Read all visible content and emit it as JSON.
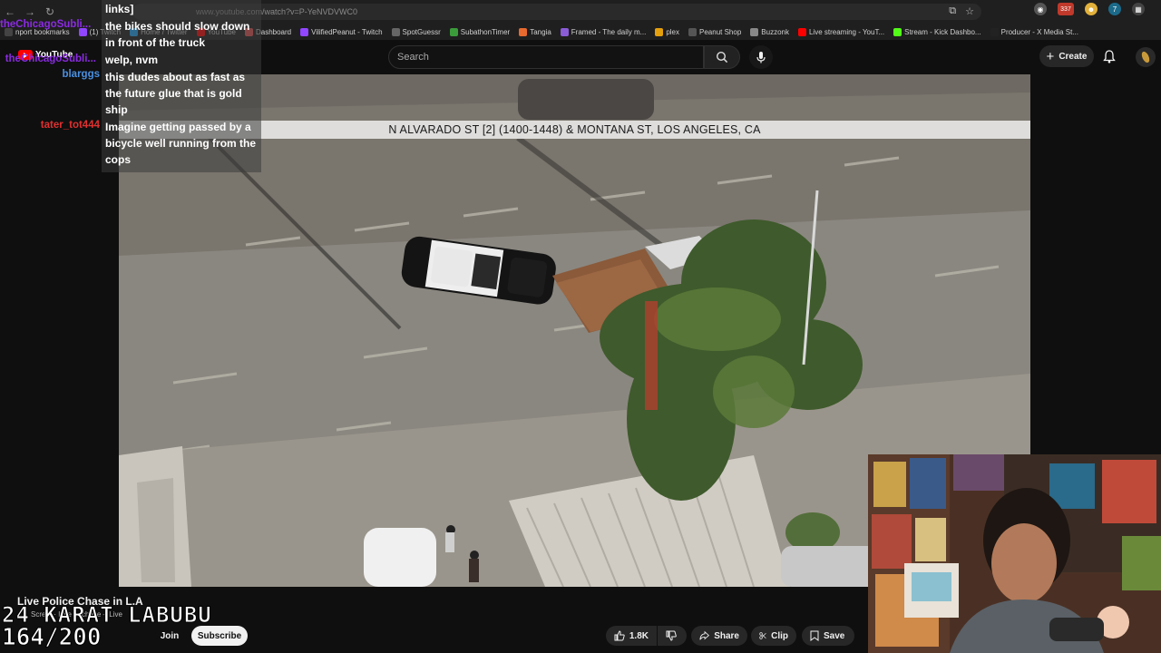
{
  "browser": {
    "url": "www.youtube.com/watch?v=P-YeNVDVWC0",
    "nav_icons": [
      "back-icon",
      "forward-icon",
      "reload-icon"
    ],
    "bookmarks": [
      {
        "label": "nport bookmarks",
        "color": "#444444"
      },
      {
        "label": "(1) Twitch",
        "color": "#9146ff"
      },
      {
        "label": "Home / Twitter",
        "color": "#1da1f2"
      },
      {
        "label": "YouTube",
        "color": "#ff0000"
      },
      {
        "label": "Dashboard",
        "color": "#e05050"
      },
      {
        "label": "VilifiedPeanut - Twitch",
        "color": "#9146ff"
      },
      {
        "label": "SpotGuessr",
        "color": "#666666"
      },
      {
        "label": "SubathonTimer",
        "color": "#3b9b3b"
      },
      {
        "label": "Tangia",
        "color": "#e86a2e"
      },
      {
        "label": "Framed - The daily m...",
        "color": "#8a5cd6"
      },
      {
        "label": "plex",
        "color": "#e5a00d"
      },
      {
        "label": "Peanut Shop",
        "color": "#555555"
      },
      {
        "label": "Buzzonk",
        "color": "#888888"
      },
      {
        "label": "Live streaming - YouT...",
        "color": "#ff0000"
      },
      {
        "label": "Stream - Kick Dashbo...",
        "color": "#53fc18"
      },
      {
        "label": "Producer - X Media St...",
        "color": "#222222"
      }
    ],
    "extension_badge": "337"
  },
  "youtube": {
    "logo_text": "YouTube",
    "search_placeholder": "Search",
    "create_label": "Create"
  },
  "video": {
    "caption": "N ALVARADO ST [2] (1400-1448) & MONTANA ST, LOS ANGELES, CA",
    "title": "Live Police Chase in L.A",
    "channel_ghost": "Scre... · Live ... chase – Live",
    "join_label": "Join",
    "subscribe_label": "Subscribe",
    "likes": "1.8K",
    "share_label": "Share",
    "clip_label": "Clip",
    "save_label": "Save"
  },
  "chat": {
    "header_fragment": "links]",
    "messages": [
      {
        "user": "theChicagoSubli...",
        "user_color": "#8a2be2",
        "text": "the bikes should slow down in front of the truck"
      },
      {
        "user": "theChicagoSubli...",
        "user_color": "#8a2be2",
        "text": "welp, nvm"
      },
      {
        "user": "blarggs",
        "user_color": "#4a90e2",
        "text": "this dudes about as fast as the future glue that is gold ship"
      },
      {
        "user": "tater_tot444",
        "user_color": "#e03030",
        "text": "Imagine getting passed by a bicycle well running from the cops"
      }
    ]
  },
  "overlay": {
    "sub_goal_name": "24 KARAT LABUBU",
    "sub_goal_count": "164/200"
  }
}
